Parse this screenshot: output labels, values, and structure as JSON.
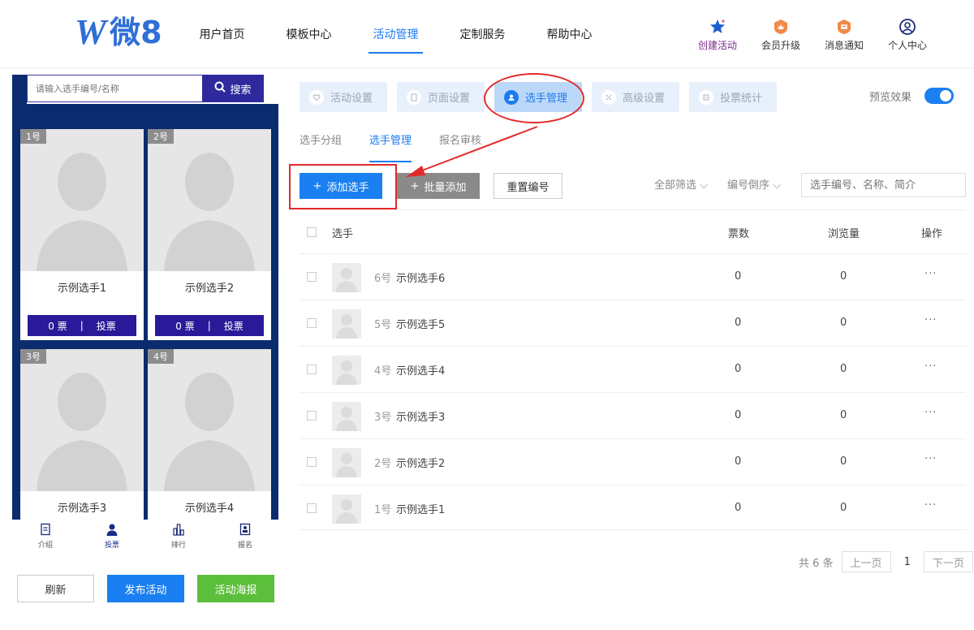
{
  "header": {
    "logo_text": "微8",
    "nav": [
      "用户首页",
      "模板中心",
      "活动管理",
      "定制服务",
      "帮助中心"
    ],
    "active_nav": 2,
    "icons": [
      {
        "label": "创建活动",
        "icon": "star-icon"
      },
      {
        "label": "会员升级",
        "icon": "crown-icon"
      },
      {
        "label": "消息通知",
        "icon": "bell-icon"
      },
      {
        "label": "个人中心",
        "icon": "user-circle-icon"
      }
    ]
  },
  "phone": {
    "search_placeholder": "请输入选手编号/名称",
    "search_button": "搜索",
    "cards": [
      {
        "num": "1号",
        "name": "示例选手1",
        "votes": "0 票",
        "vote_btn": "投票"
      },
      {
        "num": "2号",
        "name": "示例选手2",
        "votes": "0 票",
        "vote_btn": "投票"
      },
      {
        "num": "3号",
        "name": "示例选手3"
      },
      {
        "num": "4号",
        "name": "示例选手4"
      }
    ],
    "tabs": [
      "介绍",
      "投票",
      "排行",
      "报名"
    ],
    "active_tab": 1
  },
  "bottom_buttons": {
    "refresh": "刷新",
    "publish": "发布活动",
    "poster": "活动海报"
  },
  "steps": [
    "活动设置",
    "页面设置",
    "选手管理",
    "高级设置",
    "投票统计"
  ],
  "active_step": 2,
  "preview_label": "预览效果",
  "subtabs": [
    "选手分组",
    "选手管理",
    "报名审核"
  ],
  "active_subtab": 1,
  "toolbar": {
    "add": "添加选手",
    "batch_add": "批量添加",
    "reset_numbers": "重置编号",
    "filter_all": "全部筛选",
    "sort_by_number": "编号倒序",
    "search_placeholder": "选手编号、名称、简介"
  },
  "table": {
    "headers": {
      "player": "选手",
      "votes": "票数",
      "views": "浏览量",
      "ops": "操作"
    },
    "rows": [
      {
        "no": "6号",
        "name": "示例选手6",
        "votes": "0",
        "views": "0",
        "ops": "···"
      },
      {
        "no": "5号",
        "name": "示例选手5",
        "votes": "0",
        "views": "0",
        "ops": "···"
      },
      {
        "no": "4号",
        "name": "示例选手4",
        "votes": "0",
        "views": "0",
        "ops": "···"
      },
      {
        "no": "3号",
        "name": "示例选手3",
        "votes": "0",
        "views": "0",
        "ops": "···"
      },
      {
        "no": "2号",
        "name": "示例选手2",
        "votes": "0",
        "views": "0",
        "ops": "···"
      },
      {
        "no": "1号",
        "name": "示例选手1",
        "votes": "0",
        "views": "0",
        "ops": "···"
      }
    ]
  },
  "pager": {
    "total": "共 6 条",
    "prev": "上一页",
    "current": "1",
    "next": "下一页"
  },
  "colors": {
    "primary": "#1a7ff0",
    "brand": "#2f6fd6",
    "phone_bg": "#0a2b6e",
    "vote_bar": "#2a1a9a",
    "annotation_red": "#e32a2a",
    "publish_green": "#5cbf3c"
  }
}
